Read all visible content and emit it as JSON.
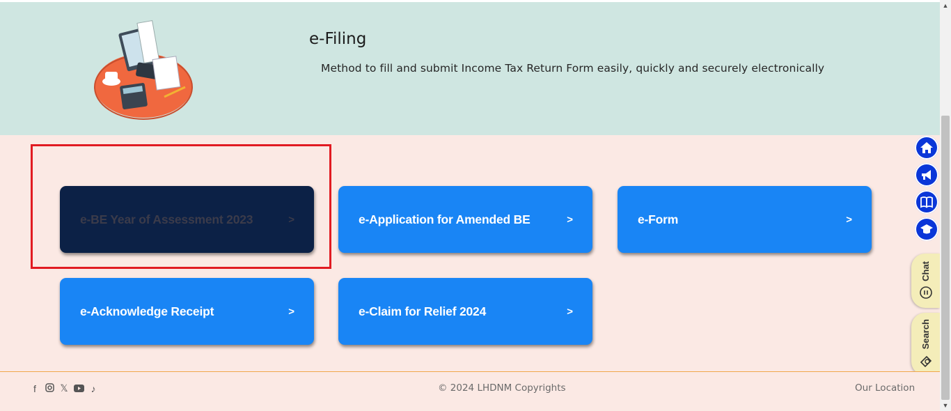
{
  "hero": {
    "title": "e-Filing",
    "description": "Method to fill and submit Income Tax Return Form easily, quickly and securely electronically"
  },
  "cards": [
    {
      "label": "e-BE Year of Assessment 2023",
      "chevron": ">"
    },
    {
      "label": "e-Application for Amended BE",
      "chevron": ">"
    },
    {
      "label": "e-Form",
      "chevron": ">"
    },
    {
      "label": "e-Acknowledge Receipt",
      "chevron": ">"
    },
    {
      "label": "e-Claim for Relief 2024",
      "chevron": ">"
    }
  ],
  "side_widgets": {
    "chat_label": "Chat",
    "search_label": "Search"
  },
  "footer": {
    "copyright": "© 2024 LHDNM Copyrights",
    "location": "Our Location",
    "social_icons": [
      "facebook-icon",
      "instagram-icon",
      "x-icon",
      "youtube-icon",
      "tiktok-icon"
    ]
  },
  "colors": {
    "card_blue": "#1985f5",
    "card_active": "#0c2146",
    "hero_bg": "#cfe6e1",
    "page_bg": "#fbe9e4",
    "highlight": "#e11b22",
    "side_icon_bg": "#0b36d8"
  }
}
